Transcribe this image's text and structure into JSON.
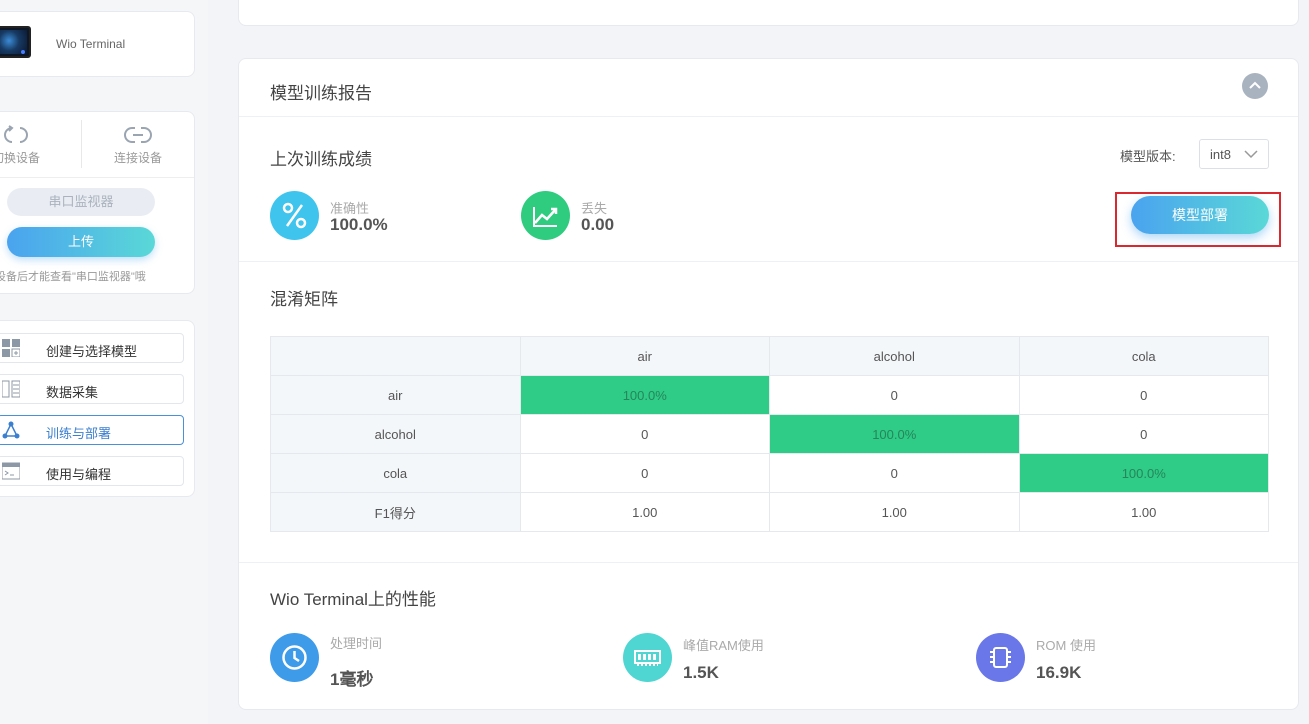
{
  "sidebar": {
    "device_name": "Wio Terminal",
    "switch_device": "切换设备",
    "connect_device": "连接设备",
    "serial_monitor": "串口监视器",
    "upload": "上传",
    "hint": "连接设备后才能查看\"串口监视器\"哦",
    "nav": [
      {
        "label": "创建与选择模型",
        "icon": "grid-icon"
      },
      {
        "label": "数据采集",
        "icon": "data-collect-icon"
      },
      {
        "label": "训练与部署",
        "icon": "train-network-icon",
        "active": true
      },
      {
        "label": "使用与编程",
        "icon": "terminal-icon"
      }
    ]
  },
  "report": {
    "title": "模型训练报告",
    "last_train_title": "上次训练成绩",
    "version_label": "模型版本:",
    "version_value": "int8",
    "accuracy_label": "准确性",
    "accuracy_value": "100.0%",
    "loss_label": "丢失",
    "loss_value": "0.00",
    "deploy_button": "模型部署",
    "confusion_title": "混淆矩阵",
    "matrix": {
      "columns": [
        "air",
        "alcohol",
        "cola"
      ],
      "rows": [
        {
          "label": "air",
          "cells": [
            "100.0%",
            "0",
            "0"
          ]
        },
        {
          "label": "alcohol",
          "cells": [
            "0",
            "100.0%",
            "0"
          ]
        },
        {
          "label": "cola",
          "cells": [
            "0",
            "0",
            "100.0%"
          ]
        },
        {
          "label": "F1得分",
          "cells": [
            "1.00",
            "1.00",
            "1.00"
          ]
        }
      ]
    },
    "perf_title": "Wio Terminal上的性能",
    "perf": [
      {
        "label": "处理时间",
        "value": "1毫秒"
      },
      {
        "label": "峰值RAM使用",
        "value": "1.5K"
      },
      {
        "label": "ROM 使用",
        "value": "16.9K"
      }
    ]
  },
  "colors": {
    "accent_gradient_start": "#4aa3ef",
    "accent_gradient_end": "#5ad8d7",
    "diagonal_green": "#2ecc86",
    "highlight_red": "#d9282f"
  }
}
